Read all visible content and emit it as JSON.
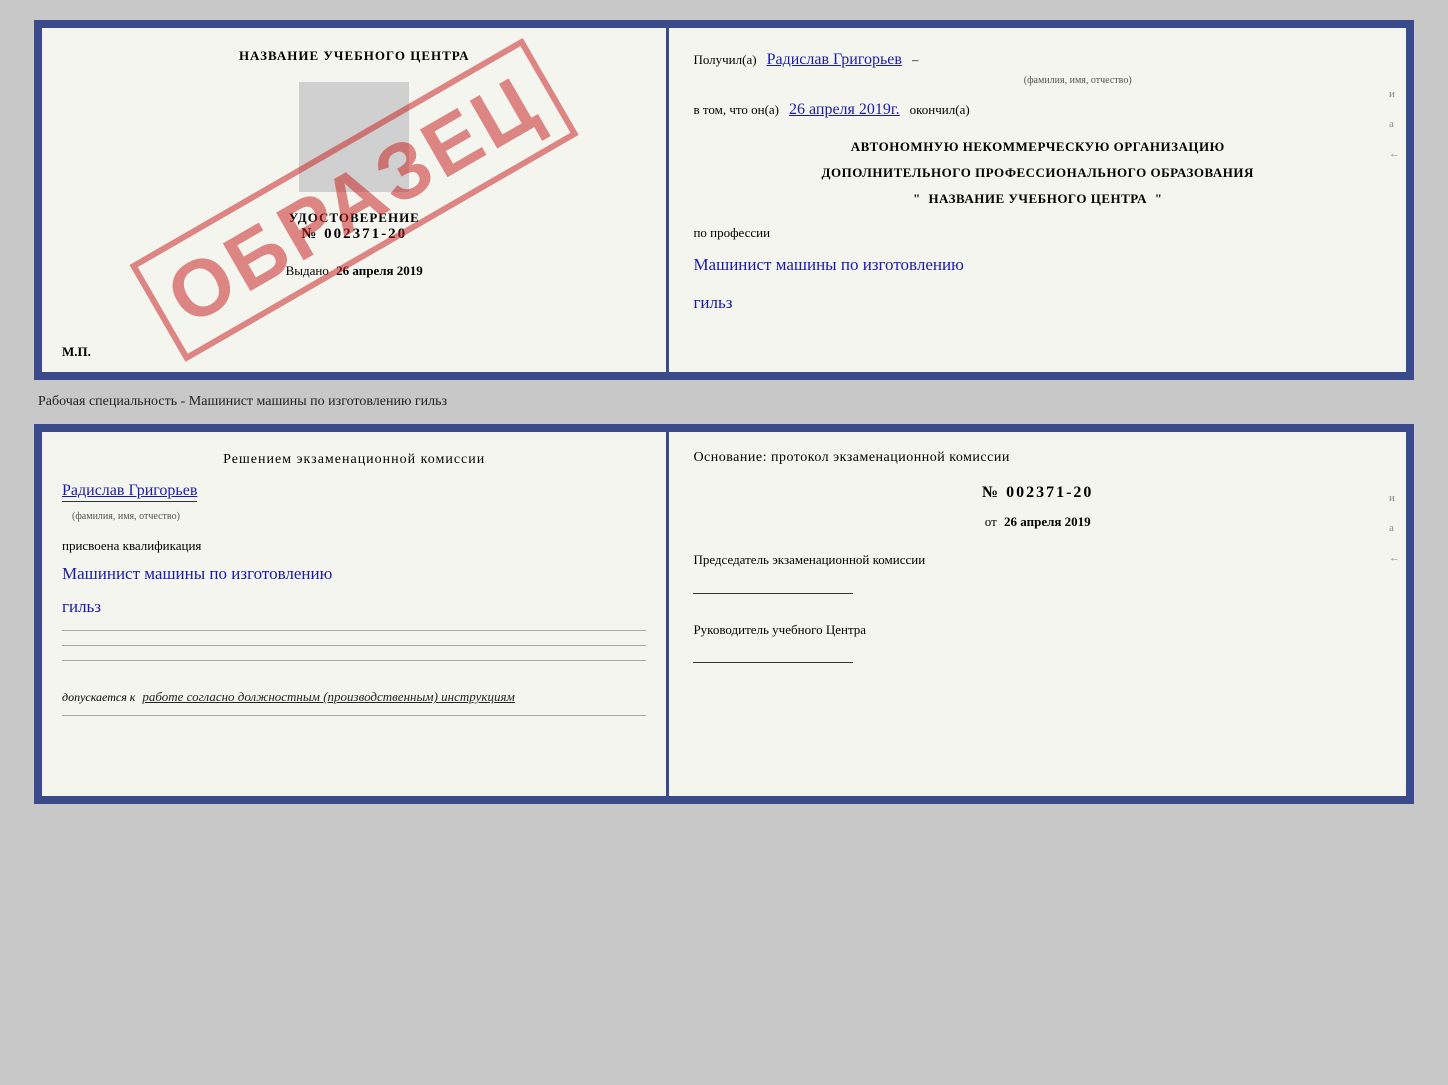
{
  "topDoc": {
    "left": {
      "schoolName": "НАЗВАНИЕ УЧЕБНОГО ЦЕНТРА",
      "udostoverenie": "УДОСТОВЕРЕНИЕ",
      "number": "№ 002371-20",
      "vydano": "Выдано",
      "vydanoDate": "26 апреля 2019",
      "mp": "М.П.",
      "watermark": "ОБРАЗЕЦ"
    },
    "right": {
      "poluchilLabel": "Получил(а)",
      "fullName": "Радислав Григорьев",
      "fioLabel": "(фамилия, имя, отчество)",
      "vtomChto": "в том, что он(а)",
      "date": "26 апреля 2019г.",
      "okonchilLabel": "окончил(а)",
      "orgLine1": "АВТОНОМНУЮ НЕКОММЕРЧЕСКУЮ ОРГАНИЗАЦИЮ",
      "orgLine2": "ДОПОЛНИТЕЛЬНОГО ПРОФЕССИОНАЛЬНОГО ОБРАЗОВАНИЯ",
      "orgQuote": "\"",
      "orgName": "НАЗВАНИЕ УЧЕБНОГО ЦЕНТРА",
      "orgQuoteEnd": "\"",
      "poProf": "по профессии",
      "profName": "Машинист машины по изготовлению",
      "profName2": "гильз",
      "sideMark1": "и",
      "sideMark2": "а",
      "sideMark3": "←"
    }
  },
  "specialtyLabel": "Рабочая специальность - Машинист машины по изготовлению гильз",
  "bottomDoc": {
    "left": {
      "reshenieTitle": "Решением  экзаменационной  комиссии",
      "fullName": "Радислав Григорьев",
      "fioLabel": "(фамилия, имя, отчество)",
      "prisvoenaKvalif": "присвоена квалификация",
      "kvalifName": "Машинист машины по изготовлению",
      "kvalifName2": "гильз",
      "dopuskaetsya": "допускается к",
      "dopuskaetsyaText": "работе согласно должностным (производственным) инструкциям"
    },
    "right": {
      "osnovanieTitle": "Основание: протокол экзаменационной  комиссии",
      "number": "№  002371-20",
      "ot": "от",
      "date": "26 апреля 2019",
      "predsedatelTitle": "Председатель экзаменационной комиссии",
      "rukovoditelTitle": "Руководитель учебного Центра",
      "sideMark1": "и",
      "sideMark2": "а",
      "sideMark3": "←"
    }
  }
}
